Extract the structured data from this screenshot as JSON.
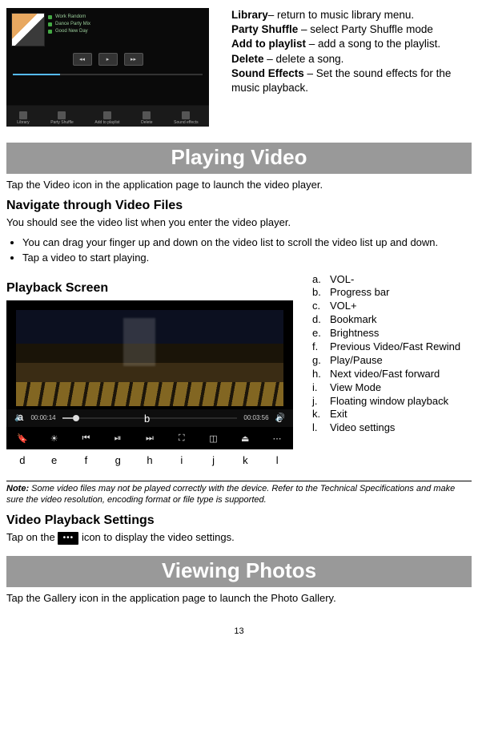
{
  "top_definitions": {
    "library_term": "Library",
    "library_def": "– return to music library menu.",
    "party_term": "Party Shuffle",
    "party_def": " – select Party Shuffle mode",
    "add_term": "Add to playlist",
    "add_def": " – add a song to the playlist.",
    "delete_term": "Delete",
    "delete_def": " – delete a song.",
    "sound_term": "Sound Effects",
    "sound_def": " – Set the sound effects for the music playback."
  },
  "thumb_tracks": [
    "Work Random",
    "Dance Party Mix",
    "Good New Day"
  ],
  "thumb_bottom_labels": [
    "Library",
    "Party Shuffle",
    "Add to playlist",
    "Delete",
    "Sound effects"
  ],
  "section_playing_video": "Playing Video",
  "pv_intro": "Tap the Video icon in the application page to launch the video player.",
  "pv_nav_heading": "Navigate through Video Files",
  "pv_nav_p": "You should see the video list when you enter the video player.",
  "pv_bullets": [
    "You can drag your finger up and down on the video list to scroll the video list up and down.",
    "Tap a video to start playing."
  ],
  "playback_heading": "Playback Screen",
  "pb_time_left": "00:00:14",
  "pb_time_right": "00:03:56",
  "pb_labels_bottom": [
    "d",
    "e",
    "f",
    "g",
    "h",
    "i",
    "j",
    "k",
    "l"
  ],
  "pb_labels_side": {
    "a": "a",
    "b": "b",
    "c": "c"
  },
  "legend": [
    {
      "k": "a.",
      "v": "VOL-"
    },
    {
      "k": "b.",
      "v": "Progress bar"
    },
    {
      "k": "c.",
      "v": "VOL+"
    },
    {
      "k": "d.",
      "v": "Bookmark"
    },
    {
      "k": "e.",
      "v": "Brightness"
    },
    {
      "k": "f.",
      "v": "Previous Video/Fast Rewind"
    },
    {
      "k": "g.",
      "v": "Play/Pause"
    },
    {
      "k": "h.",
      "v": "Next video/Fast forward"
    },
    {
      "k": "i.",
      "v": "View Mode"
    },
    {
      "k": "j.",
      "v": "Floating window playback"
    },
    {
      "k": "k.",
      "v": "Exit"
    },
    {
      "k": "l.",
      "v": "Video settings"
    }
  ],
  "note_bold": "Note:",
  "note_text": " Some video files may not be played correctly with the device. Refer to the Technical Specifications and make sure the video resolution, encoding format or file type is supported.",
  "vps_heading": "Video Playback Settings",
  "vps_pre": "Tap on the ",
  "vps_post": " icon to display the video settings.",
  "settings_icon_glyph": "•••",
  "section_viewing_photos": "Viewing Photos",
  "vp_intro": "Tap the Gallery icon in the application page to launch the Photo Gallery.",
  "page_number": "13"
}
